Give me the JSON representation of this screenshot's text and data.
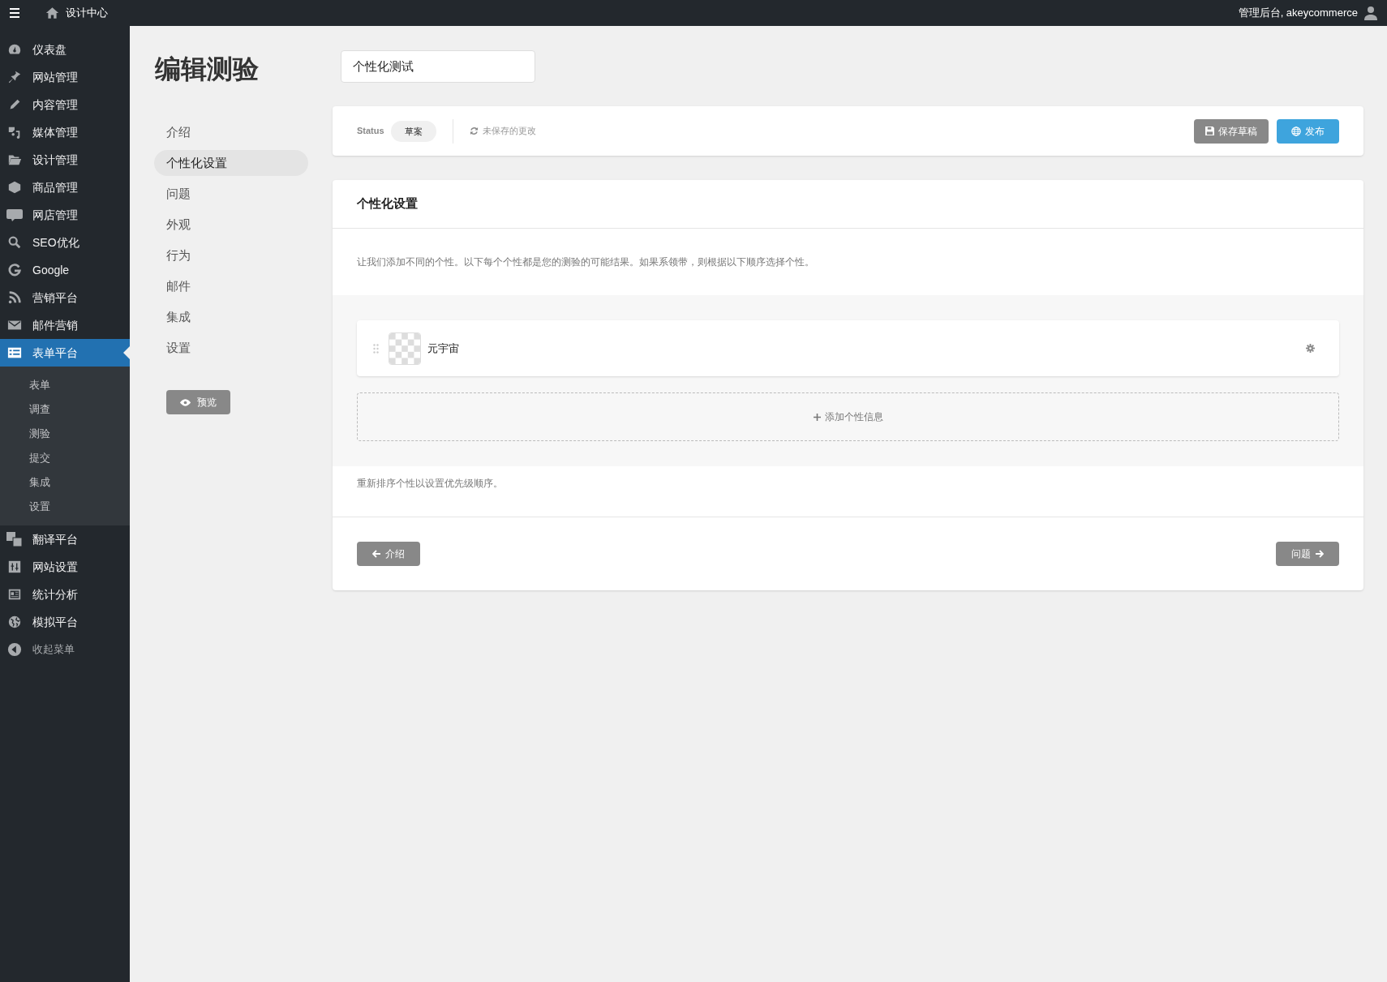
{
  "topbar": {
    "site_title": "设计中心",
    "greeting": "管理后台, akeycommerce"
  },
  "sidebar": {
    "items": [
      {
        "label": "仪表盘",
        "selected": false
      },
      {
        "label": "网站管理",
        "selected": false
      },
      {
        "label": "内容管理",
        "selected": false
      },
      {
        "label": "媒体管理",
        "selected": false
      },
      {
        "label": "设计管理",
        "selected": false
      },
      {
        "label": "商品管理",
        "selected": false
      },
      {
        "label": "网店管理",
        "selected": false
      },
      {
        "label": "SEO优化",
        "selected": false
      },
      {
        "label": "Google",
        "selected": false
      },
      {
        "label": "营销平台",
        "selected": false
      },
      {
        "label": "邮件营销",
        "selected": false
      },
      {
        "label": "表单平台",
        "selected": true,
        "children": [
          {
            "label": "表单"
          },
          {
            "label": "调查"
          },
          {
            "label": "测验"
          },
          {
            "label": "提交"
          },
          {
            "label": "集成"
          },
          {
            "label": "设置"
          }
        ]
      },
      {
        "label": "翻译平台",
        "selected": false
      },
      {
        "label": "网站设置",
        "selected": false
      },
      {
        "label": "统计分析",
        "selected": false
      },
      {
        "label": "模拟平台",
        "selected": false
      }
    ],
    "collapse": "收起菜单"
  },
  "page": {
    "title": "编辑测验",
    "quiz_name": "个性化测试"
  },
  "steps": [
    {
      "label": "介绍",
      "selected": false
    },
    {
      "label": "个性化设置",
      "selected": true
    },
    {
      "label": "问题",
      "selected": false
    },
    {
      "label": "外观",
      "selected": false
    },
    {
      "label": "行为",
      "selected": false
    },
    {
      "label": "邮件",
      "selected": false
    },
    {
      "label": "集成",
      "selected": false
    },
    {
      "label": "设置",
      "selected": false
    }
  ],
  "preview_button": "预览",
  "status_bar": {
    "status_label": "Status",
    "status": "草案",
    "unsaved": "未保存的更改",
    "save_draft": "保存草稿",
    "publish": "发布"
  },
  "panel": {
    "title": "个性化设置",
    "description": "让我们添加不同的个性。以下每个个性都是您的测验的可能结果。如果系领带，则根据以下顺序选择个性。",
    "personalities": [
      {
        "name": "元宇宙"
      }
    ],
    "add_button": "添加个性信息",
    "hint": "重新排序个性以设置优先级顺序。",
    "prev_button": "介绍",
    "next_button": "问题"
  }
}
